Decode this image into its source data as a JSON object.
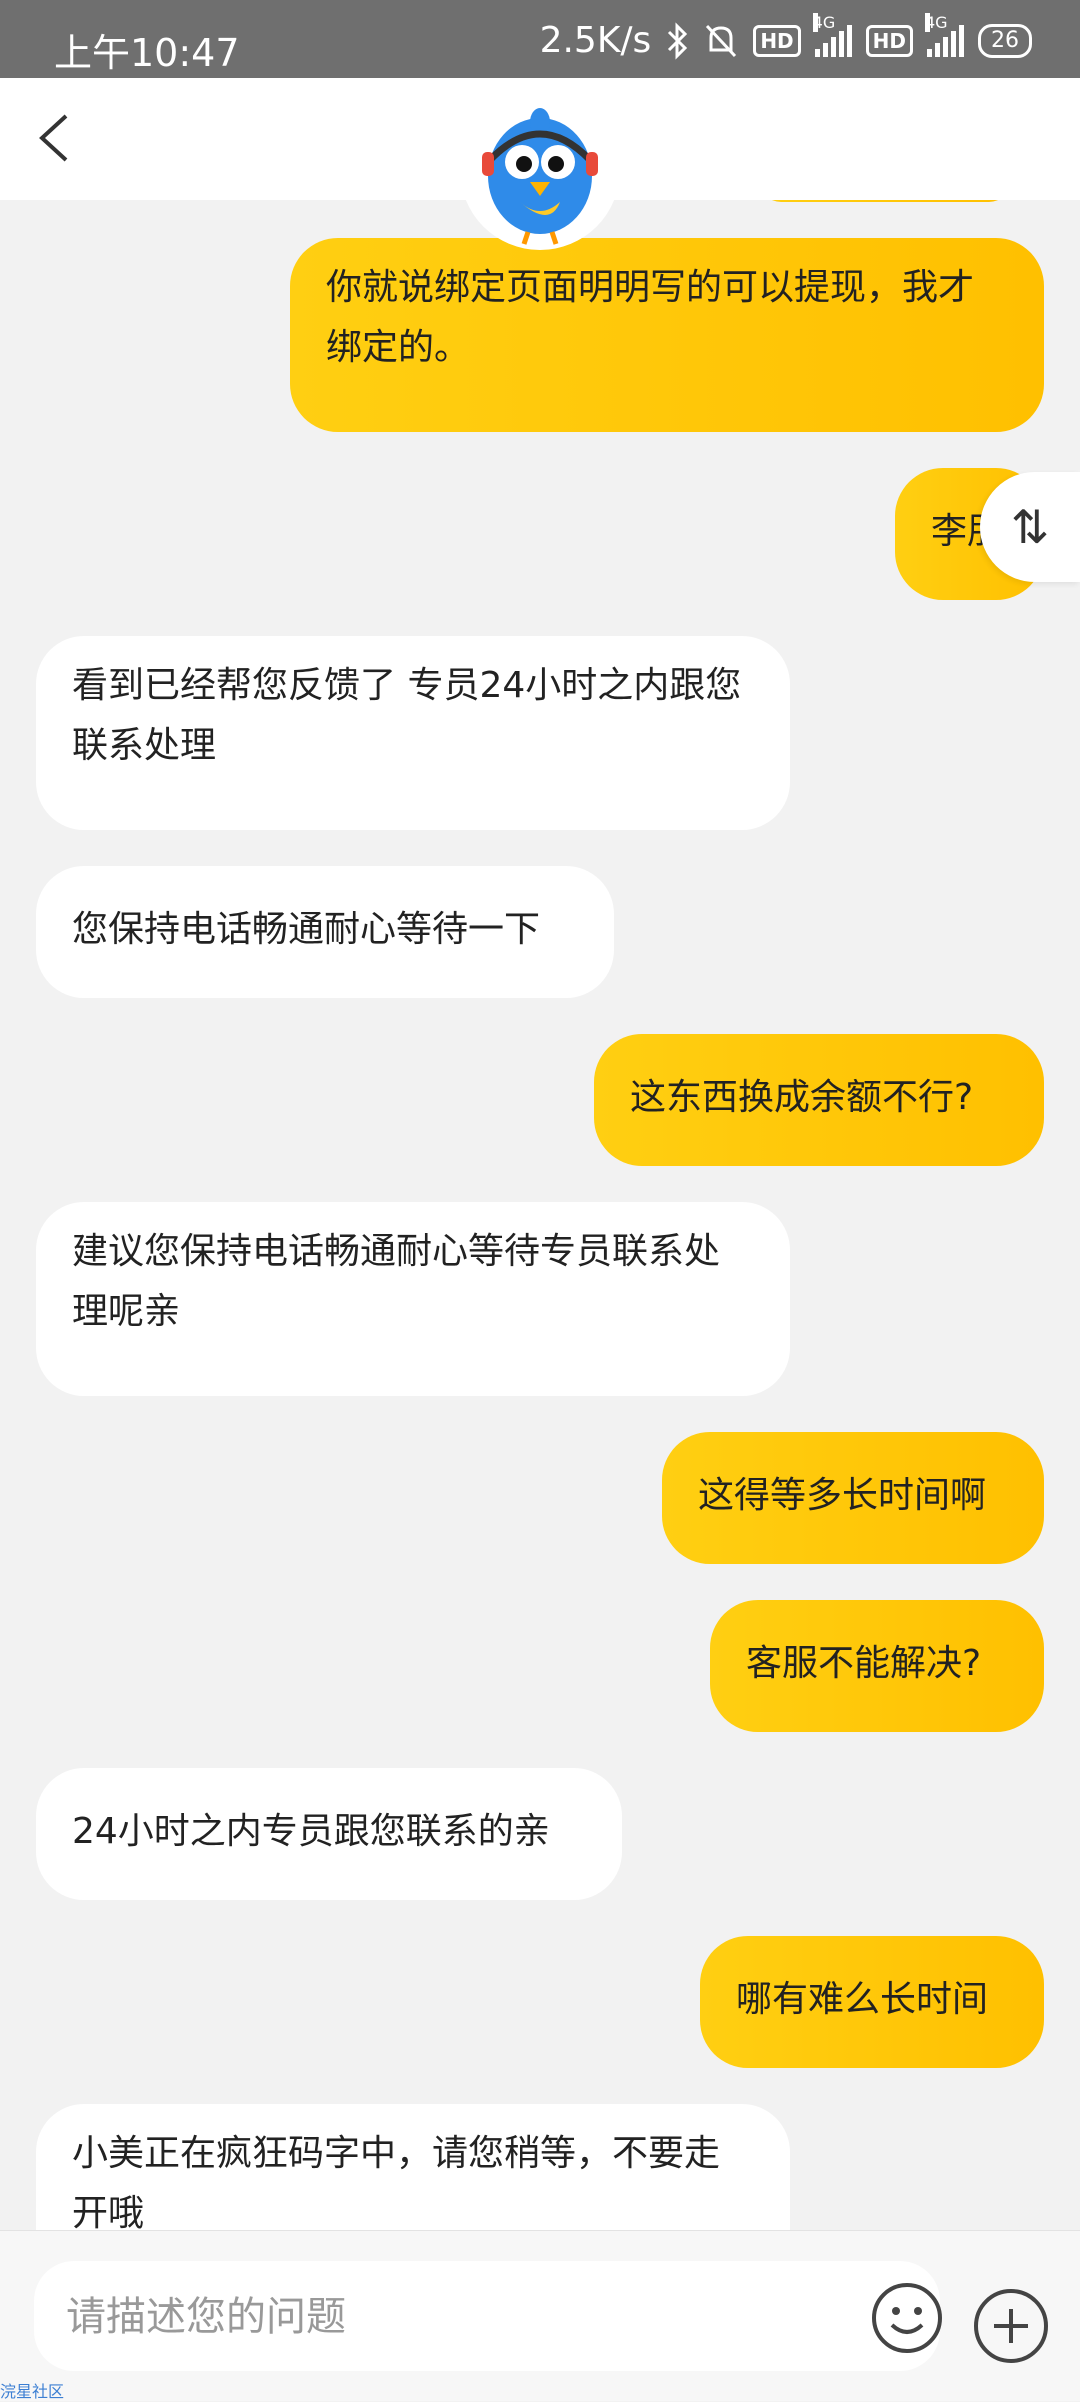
{
  "status_bar": {
    "time": "上午10:47",
    "net_speed": "2.5K/s",
    "hd1": "HD",
    "net1": "4G",
    "hd2": "HD",
    "net2": "4G",
    "battery": "26"
  },
  "chat": {
    "messages": [
      {
        "sender": "user",
        "text": "你就说绑定页面明明写的可以提现，我才绑定的。"
      },
      {
        "sender": "user",
        "text": "李朋"
      },
      {
        "sender": "service",
        "text": "看到已经帮您反馈了 专员24小时之内跟您联系处理"
      },
      {
        "sender": "service",
        "text": "您保持电话畅通耐心等待一下"
      },
      {
        "sender": "user",
        "text": "这东西换成余额不行?"
      },
      {
        "sender": "service",
        "text": "建议您保持电话畅通耐心等待专员联系处理呢亲"
      },
      {
        "sender": "user",
        "text": "这得等多长时间啊"
      },
      {
        "sender": "user",
        "text": "客服不能解决?"
      },
      {
        "sender": "service",
        "text": "24小时之内专员跟您联系的亲"
      },
      {
        "sender": "user",
        "text": "哪有难么长时间"
      },
      {
        "sender": "service",
        "text": "小美正在疯狂码字中，请您稍等，不要走开哦"
      }
    ],
    "switch_symbol": "⇅"
  },
  "input": {
    "placeholder": "请描述您的问题"
  },
  "watermark": "浣星社区",
  "colors": {
    "user_bubble": "#ffc107",
    "service_bubble": "#ffffff",
    "background": "#f2f2f2"
  }
}
